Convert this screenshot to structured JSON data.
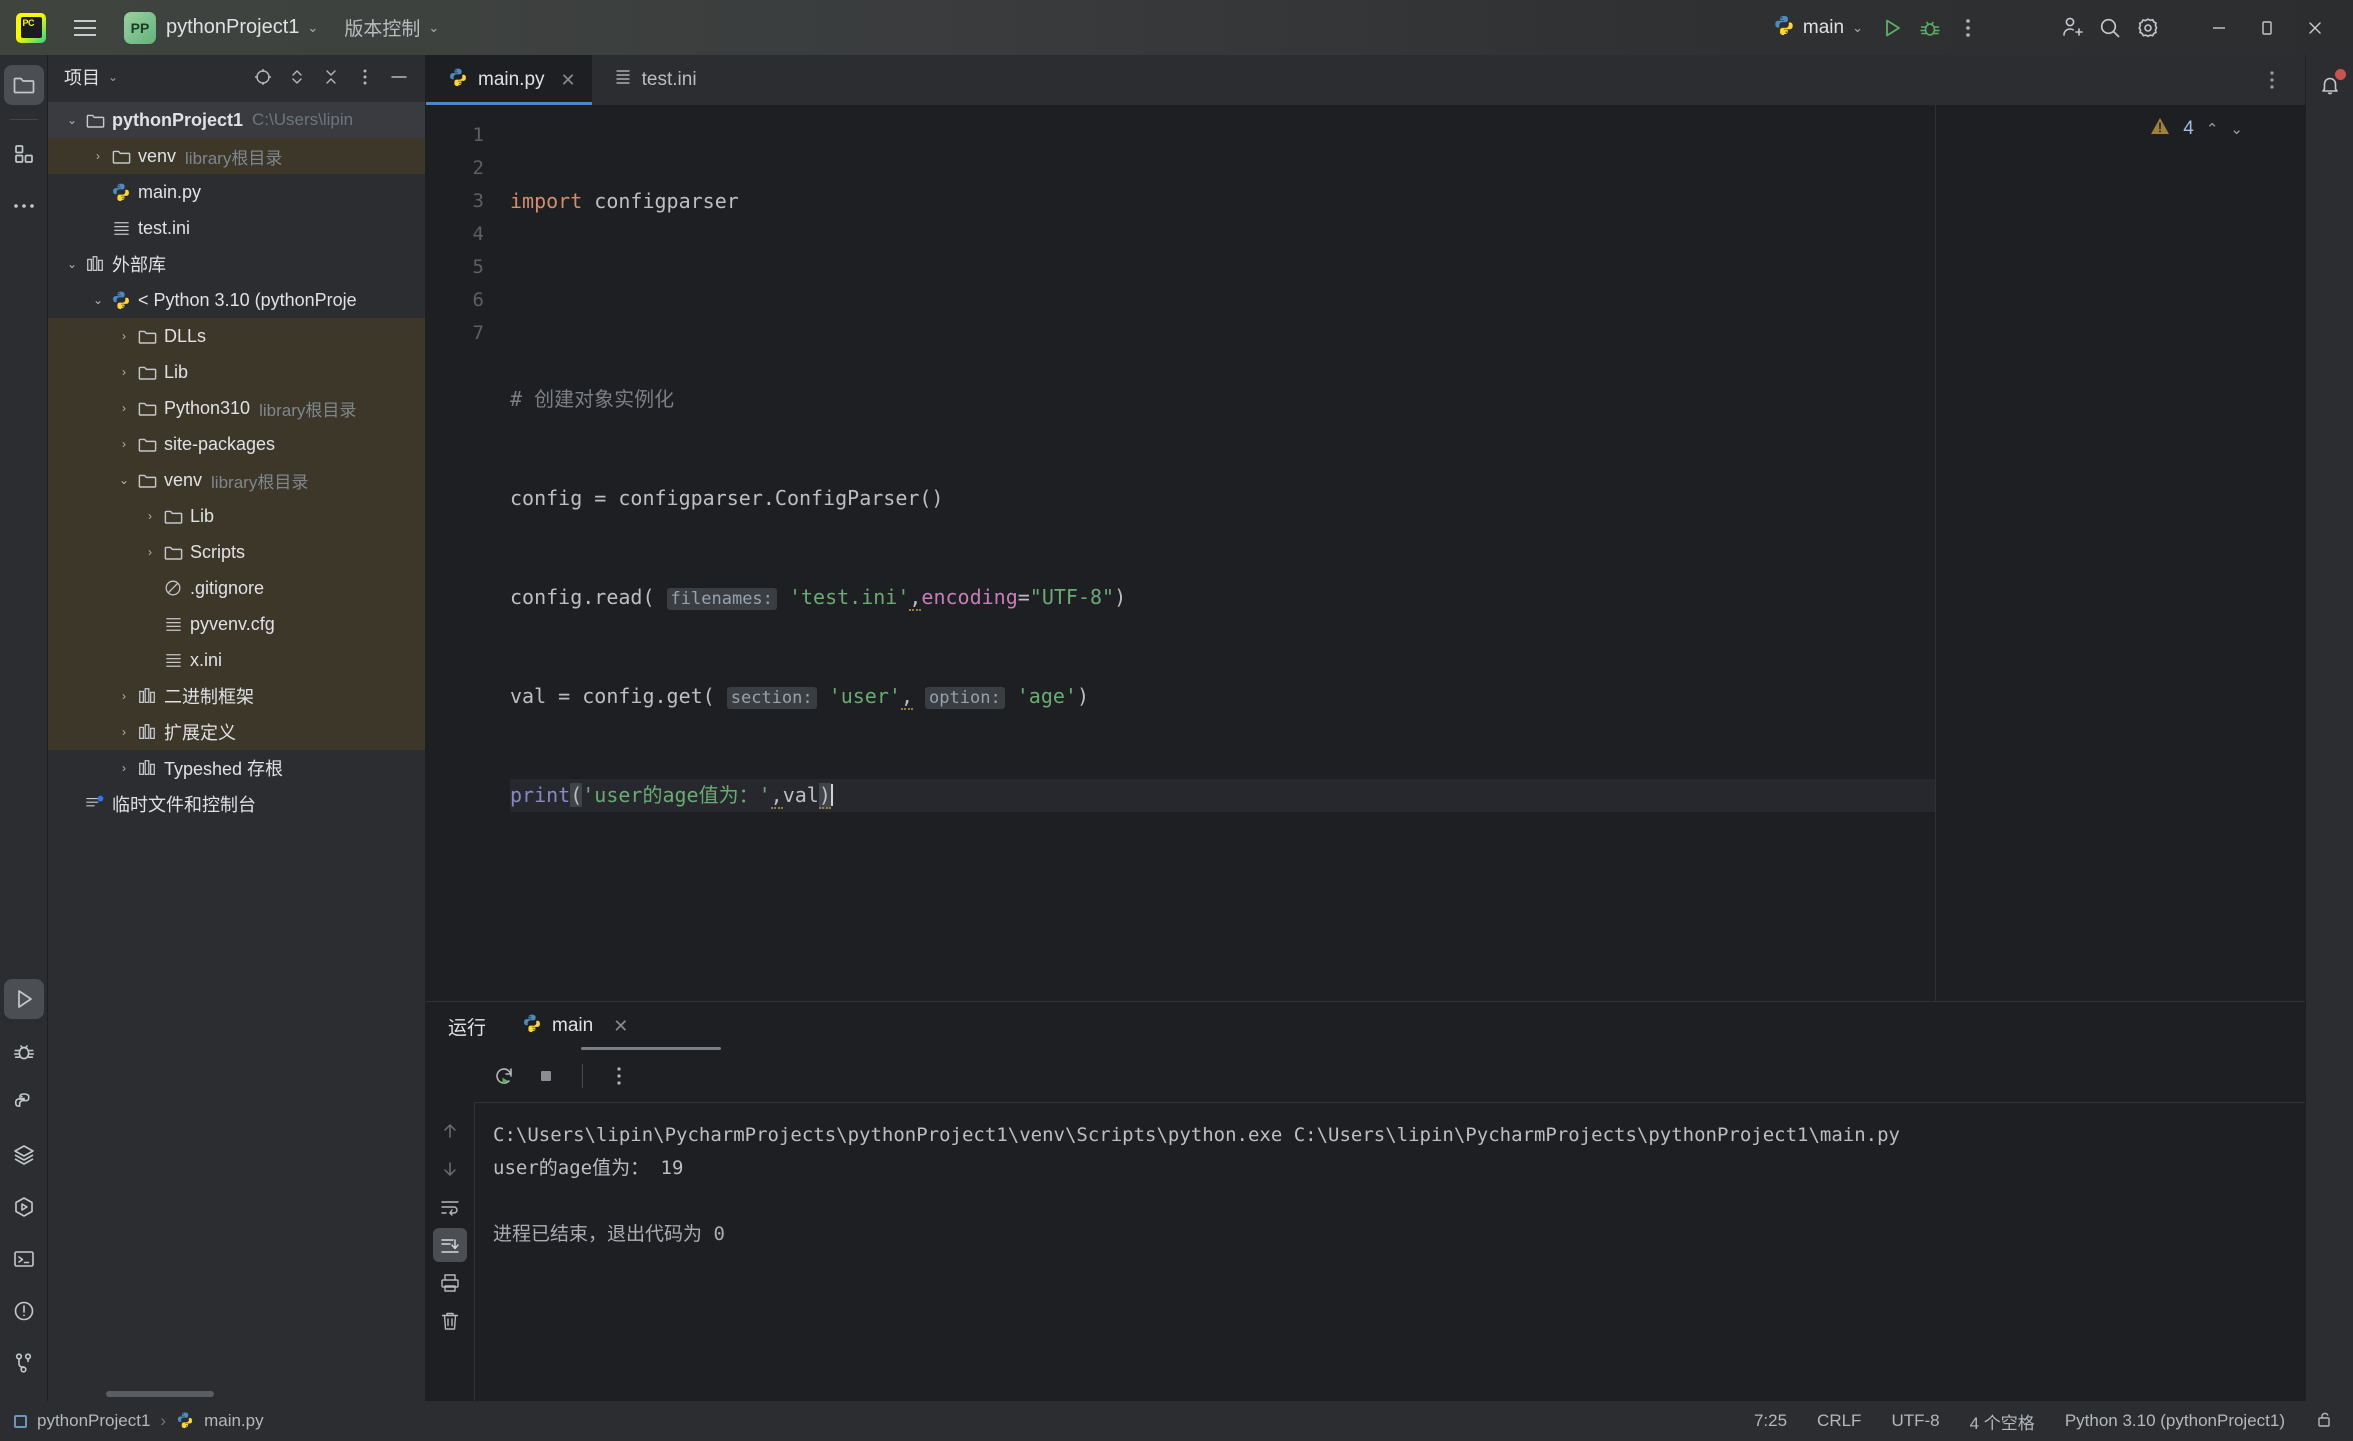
{
  "titlebar": {
    "menu_icon": "hamburger-icon",
    "logo": "pycharm-logo",
    "project_badge": "PP",
    "project_name": "pythonProject1",
    "vcs_label": "版本控制",
    "run_config_name": "main",
    "icons": [
      "run-icon",
      "debug-icon",
      "more-icon",
      "add-user-icon",
      "search-icon",
      "settings-icon"
    ],
    "window_buttons": [
      "minimize",
      "maximize",
      "close"
    ]
  },
  "rail": {
    "top_items": [
      {
        "name": "project-tool-window",
        "icon": "folder-icon",
        "active": true
      },
      {
        "name": "structure-tool-window",
        "icon": "structure-icon",
        "active": false
      },
      {
        "name": "more-tool-windows",
        "icon": "ellipsis-icon",
        "active": false
      }
    ],
    "bottom_items": [
      {
        "name": "run-tool-window",
        "icon": "run-icon",
        "active": true
      },
      {
        "name": "debug-tool-window",
        "icon": "bug-icon",
        "active": false
      },
      {
        "name": "python-packages-tool-window",
        "icon": "python-icon",
        "active": false
      },
      {
        "name": "database-tool-window",
        "icon": "layers-icon",
        "active": false
      },
      {
        "name": "python-console-tool-window",
        "icon": "hex-run-icon",
        "active": false
      },
      {
        "name": "terminal-tool-window",
        "icon": "terminal-icon",
        "active": false
      },
      {
        "name": "problems-tool-window",
        "icon": "warning-circle-icon",
        "active": false
      },
      {
        "name": "version-control-tool-window",
        "icon": "branch-icon",
        "active": false
      }
    ]
  },
  "project_panel": {
    "title": "项目",
    "header_icons": [
      "select-opened-file-icon",
      "expand-collapse-icon",
      "collapse-all-icon",
      "options-icon",
      "hide-icon"
    ],
    "tree": [
      {
        "depth": 0,
        "arrow": "down",
        "icon": "folder-icon",
        "label": "pythonProject1",
        "bold": true,
        "sub": "C:\\Users\\lipin",
        "state": "selected"
      },
      {
        "depth": 1,
        "arrow": "right",
        "icon": "folder-icon",
        "label": "venv",
        "bold": false,
        "sub": "library根目录",
        "state": "highlight"
      },
      {
        "depth": 1,
        "arrow": "none",
        "icon": "python-icon",
        "label": "main.py",
        "bold": false,
        "sub": "",
        "state": "none"
      },
      {
        "depth": 1,
        "arrow": "none",
        "icon": "ini-icon",
        "label": "test.ini",
        "bold": false,
        "sub": "",
        "state": "none"
      },
      {
        "depth": 0,
        "arrow": "down",
        "icon": "library-icon",
        "label": "外部库",
        "bold": false,
        "sub": "",
        "state": "none"
      },
      {
        "depth": 1,
        "arrow": "down",
        "icon": "python-icon",
        "label": "< Python 3.10 (pythonProje",
        "bold": false,
        "sub": "",
        "state": "none"
      },
      {
        "depth": 2,
        "arrow": "right",
        "icon": "folder-icon",
        "label": "DLLs",
        "bold": false,
        "sub": "",
        "state": "highlight"
      },
      {
        "depth": 2,
        "arrow": "right",
        "icon": "folder-icon",
        "label": "Lib",
        "bold": false,
        "sub": "",
        "state": "highlight"
      },
      {
        "depth": 2,
        "arrow": "right",
        "icon": "folder-icon",
        "label": "Python310",
        "bold": false,
        "sub": "library根目录",
        "state": "highlight"
      },
      {
        "depth": 2,
        "arrow": "right",
        "icon": "folder-icon",
        "label": "site-packages",
        "bold": false,
        "sub": "",
        "state": "highlight"
      },
      {
        "depth": 2,
        "arrow": "down",
        "icon": "folder-icon",
        "label": "venv",
        "bold": false,
        "sub": "library根目录",
        "state": "highlight"
      },
      {
        "depth": 3,
        "arrow": "right",
        "icon": "folder-icon",
        "label": "Lib",
        "bold": false,
        "sub": "",
        "state": "highlight"
      },
      {
        "depth": 3,
        "arrow": "right",
        "icon": "folder-icon",
        "label": "Scripts",
        "bold": false,
        "sub": "",
        "state": "highlight"
      },
      {
        "depth": 3,
        "arrow": "none",
        "icon": "gitignore-icon",
        "label": ".gitignore",
        "bold": false,
        "sub": "",
        "state": "highlight"
      },
      {
        "depth": 3,
        "arrow": "none",
        "icon": "ini-icon",
        "label": "pyvenv.cfg",
        "bold": false,
        "sub": "",
        "state": "highlight"
      },
      {
        "depth": 3,
        "arrow": "none",
        "icon": "ini-icon",
        "label": "x.ini",
        "bold": false,
        "sub": "",
        "state": "highlight"
      },
      {
        "depth": 2,
        "arrow": "right",
        "icon": "library-icon",
        "label": "二进制框架",
        "bold": false,
        "sub": "",
        "state": "highlight"
      },
      {
        "depth": 2,
        "arrow": "right",
        "icon": "library-icon",
        "label": "扩展定义",
        "bold": false,
        "sub": "",
        "state": "highlight"
      },
      {
        "depth": 2,
        "arrow": "right",
        "icon": "library-icon",
        "label": "Typeshed 存根",
        "bold": false,
        "sub": "",
        "state": "none"
      },
      {
        "depth": 0,
        "arrow": "none",
        "icon": "scratches-icon",
        "label": "临时文件和控制台",
        "bold": false,
        "sub": "",
        "state": "none"
      }
    ]
  },
  "editor": {
    "tabs": [
      {
        "label": "main.py",
        "icon": "python-icon",
        "active": true,
        "closable": true
      },
      {
        "label": "test.ini",
        "icon": "ini-icon",
        "active": false,
        "closable": false
      }
    ],
    "more_icon": "more-vertical-icon",
    "notification_icon": "bell-icon",
    "inspection": {
      "icon": "warning-triangle-icon",
      "count": "4",
      "up": "⌃",
      "down": "⌄"
    },
    "line_numbers": [
      "1",
      "2",
      "3",
      "4",
      "5",
      "6",
      "7"
    ],
    "code": {
      "l1_kw": "import",
      "l1_mod": "configparser",
      "l3_comment": "# 创建对象实例化",
      "l4_a": "config = configparser.ConfigParser()",
      "l5_obj": "config.read(",
      "l5_hint": "filenames:",
      "l5_str": "'test.ini'",
      "l5_comma": ",",
      "l5_named": "encoding",
      "l5_eq": "=",
      "l5_str2": "\"UTF-8\"",
      "l5_close": ")",
      "l6_a": "val = config.get(",
      "l6_hint1": "section:",
      "l6_str1": "'user'",
      "l6_comma": ",",
      "l6_hint2": "option:",
      "l6_str2": "'age'",
      "l6_close": ")",
      "l7_fn": "print",
      "l7_open": "(",
      "l7_str": "'user的age值为：'",
      "l7_comma": ",",
      "l7_var": "val",
      "l7_close": ")"
    }
  },
  "run_panel": {
    "title": "运行",
    "tab": {
      "label": "main",
      "icon": "python-icon"
    },
    "toolbar": [
      "rerun-icon",
      "stop-icon",
      "more-icon"
    ],
    "gutter_icons": [
      "up-arrow-icon",
      "down-arrow-icon",
      "soft-wrap-icon",
      "scroll-to-end-icon",
      "print-icon",
      "clear-all-icon"
    ],
    "console": {
      "line1": "C:\\Users\\lipin\\PycharmProjects\\pythonProject1\\venv\\Scripts\\python.exe C:\\Users\\lipin\\PycharmProjects\\pythonProject1\\main.py",
      "line2": "user的age值为： 19",
      "line3": "",
      "line4": "进程已结束，退出代码为 0"
    }
  },
  "statusbar": {
    "breadcrumb_project": "pythonProject1",
    "breadcrumb_sep": "›",
    "breadcrumb_file": "main.py",
    "caret_position": "7:25",
    "line_separator": "CRLF",
    "encoding": "UTF-8",
    "indent": "4 个空格",
    "interpreter": "Python 3.10 (pythonProject1)",
    "lock_icon": "unlocked-icon"
  }
}
